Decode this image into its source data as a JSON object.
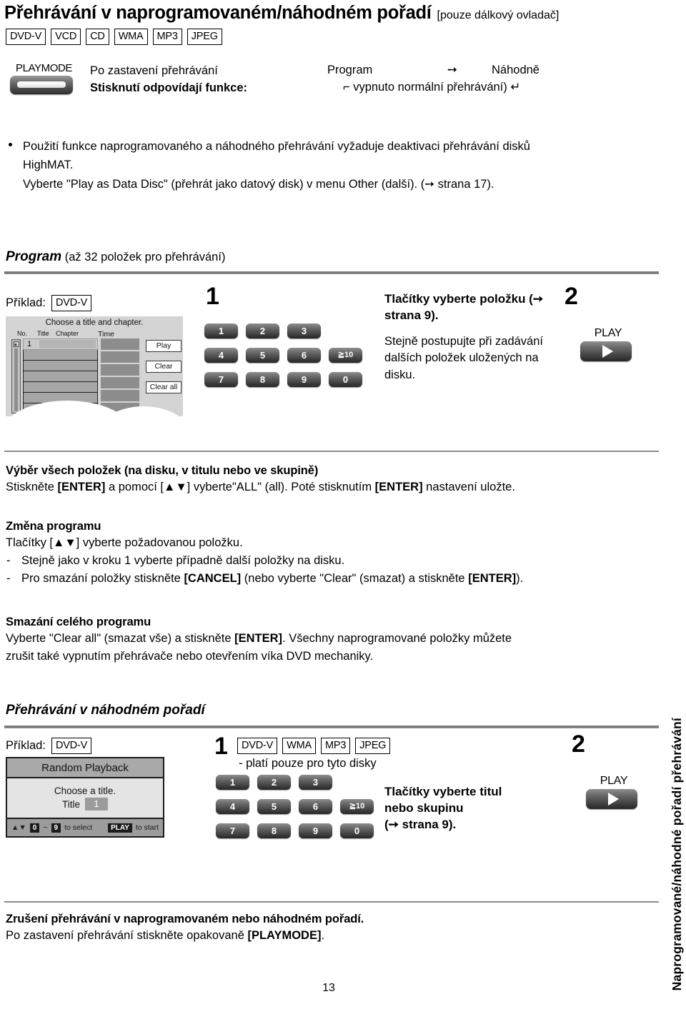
{
  "doc": {
    "title": "Přehrávání v naprogramovaném/náhodném pořadí",
    "title_note": "[pouze dálkový ovladač]",
    "page_number": "13",
    "side_tab": "Naprogramované/náhodné pořadí přehrávání"
  },
  "disc_badges_main": [
    "DVD-V",
    "VCD",
    "CD",
    "WMA",
    "MP3",
    "JPEG"
  ],
  "playmode": {
    "key_label": "PLAYMODE",
    "line1": "Po zastavení přehrávání",
    "line2": "Stisknutí odpovídají funkce:",
    "flow_left": "Program",
    "flow_arrow": "➙",
    "flow_right": "Náhodně",
    "flow_bottom": "⌐ vypnuto normální přehrávání) ↵"
  },
  "bullet": {
    "line1": "Použití funkce naprogramovaného a náhodného přehrávání vyžaduje deaktivaci přehrávání disků",
    "line2": "HighMAT.",
    "line3": "Vyberte \"Play as Data Disc\" (přehrát jako datový disk) v menu Other (další). (➙ strana 17)."
  },
  "program_section": {
    "heading_main": "Program",
    "heading_sub": " (až 32 položek pro přehrávání)",
    "example_label": "Příklad:",
    "example_badge": "DVD-V",
    "screen": {
      "title": "Choose a title and chapter.",
      "col_no": "No.",
      "col_title": "Title",
      "col_chapter": "Chapter",
      "col_time": "Time",
      "first_row_number": "1",
      "buttons": [
        "Play",
        "Clear",
        "Clear all"
      ]
    },
    "step1_number": "1",
    "step2_number": "2",
    "keypad": [
      [
        "1",
        "2",
        "3",
        ""
      ],
      [
        "4",
        "5",
        "6",
        "≧10"
      ],
      [
        "7",
        "8",
        "9",
        "0"
      ]
    ],
    "step1_text_bold": "Tlačítky vyberte položku (➙ strana 9).",
    "step1_text_norm": "Stejně postupujte při zadávání dalších položek uložených na disku.",
    "play_key_label": "PLAY"
  },
  "all_items_section": {
    "heading": "Výběr všech položek (na disku, v titulu nebo ve skupině)",
    "body_parts": [
      {
        "t": "Stiskněte ",
        "b": false
      },
      {
        "t": "[ENTER]",
        "b": true
      },
      {
        "t": " a pomocí [▲▼] vyberte\"ALL\" (all). Poté stisknutím ",
        "b": false
      },
      {
        "t": "[ENTER]",
        "b": true
      },
      {
        "t": " nastavení uložte.",
        "b": false
      }
    ]
  },
  "change_program_section": {
    "heading": "Změna programu",
    "body": "Tlačítky [▲▼] vyberte požadovanou položku.",
    "item1": "Stejně jako v kroku 1 vyberte případně další položky na disku.",
    "item2_parts": [
      {
        "t": "Pro smazání položky stiskněte ",
        "b": false
      },
      {
        "t": "[CANCEL]",
        "b": true
      },
      {
        "t": " (nebo vyberte \"Clear\" (smazat) a stiskněte ",
        "b": false
      },
      {
        "t": "[ENTER]",
        "b": true
      },
      {
        "t": ").",
        "b": false
      }
    ],
    "dash": "-"
  },
  "clear_all_section": {
    "heading": "Smazání celého programu",
    "line1_parts": [
      {
        "t": "Vyberte \"Clear all\" (smazat vše) a stiskněte ",
        "b": false
      },
      {
        "t": "[ENTER]",
        "b": true
      },
      {
        "t": ". Všechny naprogramované položky můžete",
        "b": false
      }
    ],
    "line2": "zrušit také vypnutím přehrávače nebo otevřením víka DVD mechaniky."
  },
  "random_section": {
    "heading_main": "Přehrávání v náhodném pořadí",
    "example_label": "Příklad:",
    "example_badge": "DVD-V",
    "screen": {
      "header": "Random Playback",
      "line1": "Choose a title.",
      "line2_label": "Title",
      "line2_value": "1",
      "foot_arrows": "▲▼",
      "foot_key0": "0",
      "foot_tilde": "~",
      "foot_key9": "9",
      "foot_select": "to select",
      "foot_play": "PLAY",
      "foot_start": "to start"
    },
    "step1_number": "1",
    "step2_number": "2",
    "disc_badges": [
      "DVD-V",
      "WMA",
      "MP3",
      "JPEG"
    ],
    "badges_note": "- platí pouze pro tyto disky",
    "keypad": [
      [
        "1",
        "2",
        "3",
        ""
      ],
      [
        "4",
        "5",
        "6",
        "≧10"
      ],
      [
        "7",
        "8",
        "9",
        "0"
      ]
    ],
    "step_text_bold_l1": "Tlačítky vyberte titul",
    "step_text_bold_l2": "nebo skupinu",
    "step_text_bold_l3": "(➙ strana 9).",
    "play_key_label": "PLAY"
  },
  "cancel_section": {
    "heading": "Zrušení přehrávání v naprogramovaném nebo náhodném pořadí.",
    "body_parts": [
      {
        "t": "Po zastavení přehrávání stiskněte opakovaně ",
        "b": false
      },
      {
        "t": "[PLAYMODE]",
        "b": true
      },
      {
        "t": ".",
        "b": false
      }
    ]
  },
  "colors": {
    "rule": "#7b7b7b",
    "screen_bg": "#d4d4d4",
    "key_dark": "#2a2a2a"
  }
}
